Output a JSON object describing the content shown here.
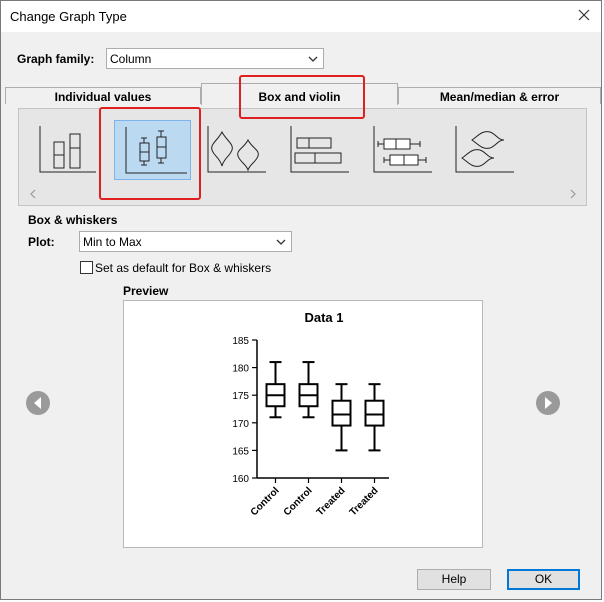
{
  "window": {
    "title": "Change Graph Type"
  },
  "graph_family": {
    "label": "Graph family:",
    "value": "Column"
  },
  "tabs": [
    {
      "label": "Individual values",
      "active": false
    },
    {
      "label": "Box and violin",
      "active": true
    },
    {
      "label": "Mean/median & error",
      "active": false
    }
  ],
  "graph_icons": [
    "column-scatter-icon",
    "box-whiskers-icon",
    "violin-icon",
    "horizontal-box-icon",
    "horizontal-box-whiskers-icon",
    "horizontal-violin-icon"
  ],
  "selected_icon": "box-whiskers-icon",
  "section": {
    "title": "Box & whiskers",
    "plot_label": "Plot:",
    "plot_value": "Min to Max",
    "default_checkbox_label": "Set as default for Box & whiskers",
    "default_checked": false
  },
  "preview": {
    "label": "Preview",
    "chart_data": {
      "type": "box",
      "title": "Data 1",
      "categories": [
        "Control",
        "Control",
        "Treated",
        "Treated"
      ],
      "ylim": [
        160,
        185
      ],
      "yticks": [
        "160",
        "165",
        "170",
        "175",
        "180",
        "185"
      ],
      "boxes": [
        {
          "min": 171,
          "q1": 173,
          "median": 175,
          "q3": 177,
          "max": 181
        },
        {
          "min": 171,
          "q1": 173,
          "median": 175,
          "q3": 177,
          "max": 181
        },
        {
          "min": 165,
          "q1": 169.5,
          "median": 171.5,
          "q3": 174,
          "max": 177
        },
        {
          "min": 165,
          "q1": 169.5,
          "median": 171.5,
          "q3": 174,
          "max": 177
        }
      ]
    }
  },
  "buttons": {
    "help": "Help",
    "ok": "OK"
  },
  "colors": {
    "highlight": "#e02020",
    "selection": "#bcd9f2",
    "default_button": "#0078d7"
  }
}
